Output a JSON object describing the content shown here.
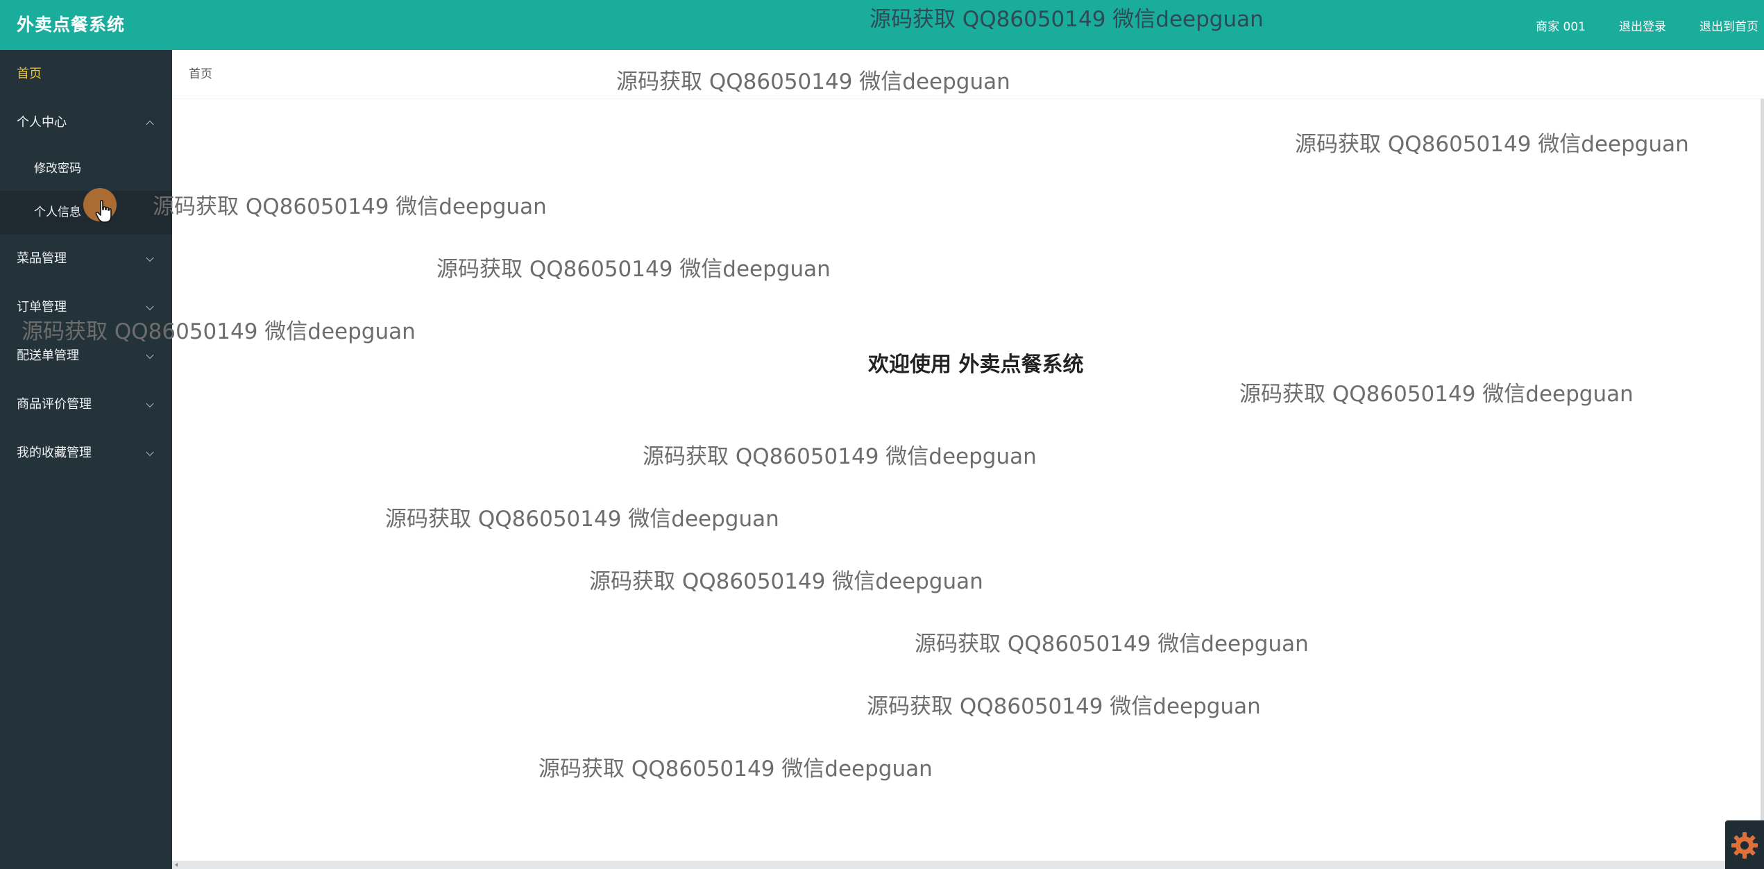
{
  "app": {
    "title": "外卖点餐系统"
  },
  "header": {
    "links": [
      {
        "label": "商家 001"
      },
      {
        "label": "退出登录"
      },
      {
        "label": "退出到首页"
      }
    ]
  },
  "sidebar": {
    "items": [
      {
        "label": "首页"
      },
      {
        "label": "个人中心",
        "children": [
          {
            "label": "修改密码"
          },
          {
            "label": "个人信息"
          }
        ]
      },
      {
        "label": "菜品管理"
      },
      {
        "label": "订单管理"
      },
      {
        "label": "配送单管理"
      },
      {
        "label": "商品评价管理"
      },
      {
        "label": "我的收藏管理"
      }
    ]
  },
  "breadcrumb": {
    "current": "首页"
  },
  "main": {
    "welcome": "欢迎使用 外卖点餐系统"
  },
  "watermark": {
    "text": "源码获取 QQ86050149 微信deepguan"
  },
  "colors": {
    "header": "#1aad9b",
    "sidebar": "#243239",
    "active": "#f0c23a"
  }
}
